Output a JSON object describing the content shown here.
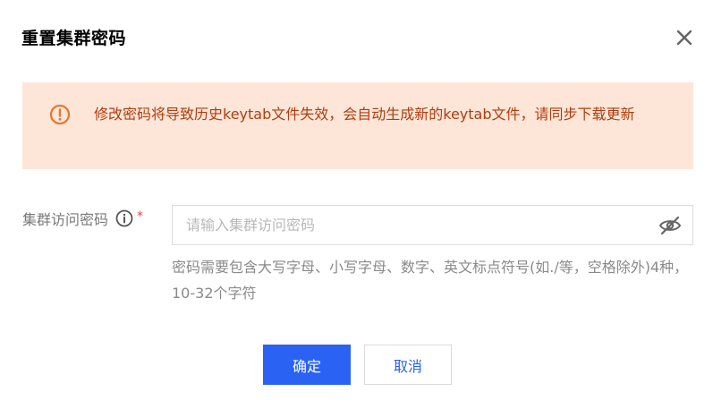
{
  "dialog": {
    "title": "重置集群密码"
  },
  "icons": {
    "close": "close-icon",
    "warning": "warning-circle-icon",
    "info": "info-circle-icon",
    "eye_off": "eye-off-icon"
  },
  "alert": {
    "message": "修改密码将导致历史keytab文件失效，会自动生成新的keytab文件，请同步下载更新",
    "background": "#fde6d8",
    "text_color": "#b23c0e",
    "icon_color": "#e8762c"
  },
  "form": {
    "password_label": "集群访问密码",
    "required_mark": "*",
    "password_value": "",
    "password_placeholder": "请输入集群访问密码",
    "hint": "密码需要包含大写字母、小写字母、数字、英文标点符号(如./等，空格除外)4种，10-32个字符"
  },
  "buttons": {
    "confirm_label": "确定",
    "cancel_label": "取消"
  },
  "colors": {
    "primary": "#2a62f3",
    "required": "#e54545"
  }
}
